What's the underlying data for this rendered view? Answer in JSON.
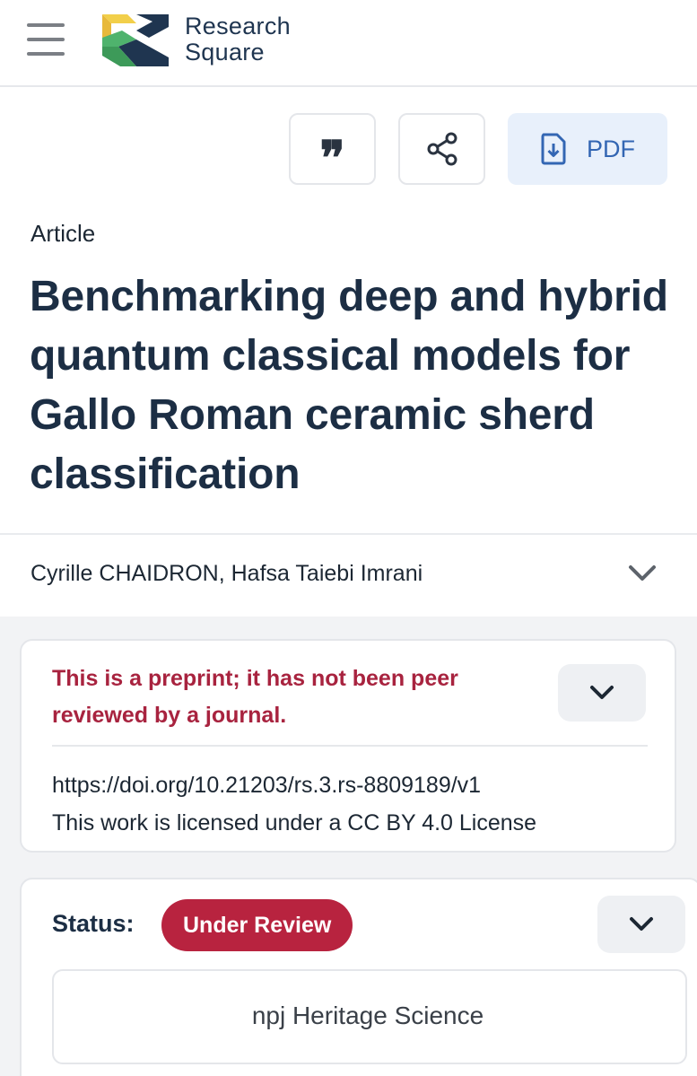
{
  "header": {
    "brand_line1": "Research",
    "brand_line2": "Square",
    "menu_icon": "hamburger-menu-icon",
    "colors": {
      "brand_dark": "#1f3550",
      "logo_yellow": "#f2cf4a",
      "logo_green": "#4fb36d",
      "logo_navy": "#1f3550"
    }
  },
  "actions": {
    "cite_icon": "quote-icon",
    "cite_glyph": "❞",
    "share_icon": "share-icon",
    "pdf_icon": "file-download-icon",
    "pdf_label": "PDF"
  },
  "article": {
    "type": "Article",
    "title": "Benchmarking deep and hybrid quantum classical models for Gallo Roman ceramic sherd classification",
    "authors": "Cyrille CHAIDRON, Hafsa Taiebi Imrani"
  },
  "preprint_card": {
    "notice": "This is a preprint; it has not been peer reviewed by a journal.",
    "doi": "https://doi.org/10.21203/rs.3.rs-8809189/v1",
    "license": "This work is licensed under a CC BY 4.0 License",
    "notice_color": "#a8233f"
  },
  "status_card": {
    "label": "Status:",
    "badge": "Under Review",
    "badge_color": "#b8233f",
    "journal": "npj Heritage Science"
  }
}
